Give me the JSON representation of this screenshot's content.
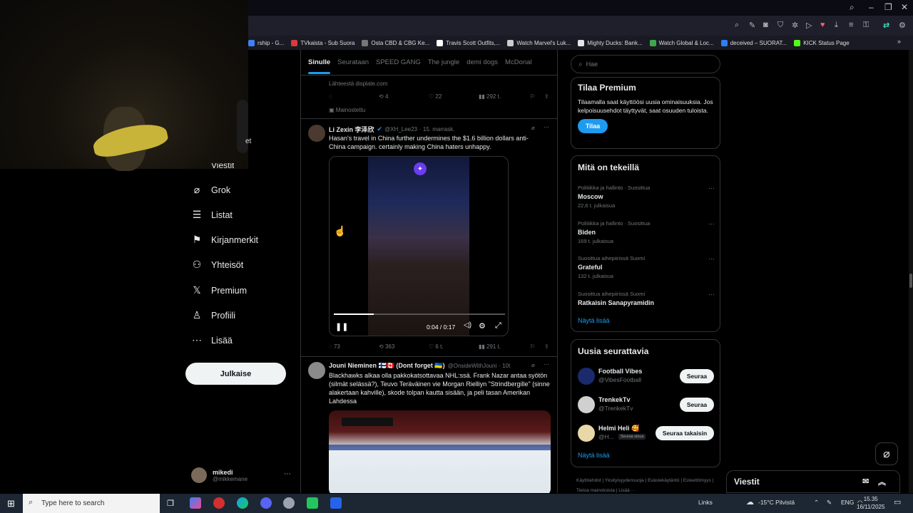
{
  "browser": {
    "bookmarks": [
      {
        "label": "rship - G...",
        "color": "#3b82f6"
      },
      {
        "label": "TVkaista - Sub Suora",
        "color": "#d83a3a"
      },
      {
        "label": "Osta CBD & CBG Ke...",
        "color": "#777777"
      },
      {
        "label": "Travis Scott Outfits,...",
        "color": "#ffffff"
      },
      {
        "label": "Watch Marvel's Luk...",
        "color": "#cccccc"
      },
      {
        "label": "Mighty Ducks: Bank...",
        "color": "#e5e5e5"
      },
      {
        "label": "Watch Global & Loc...",
        "color": "#3da84a"
      },
      {
        "label": "deceived – SUORAT...",
        "color": "#2d7ef7"
      },
      {
        "label": "KICK Status Page",
        "color": "#53fc18"
      }
    ]
  },
  "webcam": {
    "overlay_text": "et"
  },
  "sidebar": {
    "partial_top": "Viestit",
    "items": [
      {
        "label": "Grok",
        "icon": "grok-icon",
        "glyph": "⌀"
      },
      {
        "label": "Listat",
        "icon": "list-icon",
        "glyph": "☰"
      },
      {
        "label": "Kirjanmerkit",
        "icon": "bookmark-icon",
        "glyph": "⚑"
      },
      {
        "label": "Yhteisöt",
        "icon": "communities-icon",
        "glyph": "⚇"
      },
      {
        "label": "Premium",
        "icon": "x-logo-icon",
        "glyph": "𝕏"
      },
      {
        "label": "Profiili",
        "icon": "profile-icon",
        "glyph": "♙"
      },
      {
        "label": "Lisää",
        "icon": "more-icon",
        "glyph": "⋯"
      }
    ],
    "post_button": "Julkaise",
    "account": {
      "name": "mikedi",
      "handle": "@mikkemane"
    }
  },
  "feed": {
    "tabs": [
      "Sinulle",
      "Seurataan",
      "SPEED GANG",
      "The jungle",
      "demi dogs",
      "McDonal"
    ],
    "top_tweet": {
      "source": "Lähteestä displate.com",
      "retweets": "4",
      "likes": "22",
      "views": "292 t.",
      "promoted": "Mainostettu"
    },
    "tweet1": {
      "name": "Li Zexin 李泽欣",
      "handle": "@XH_Lee23",
      "date": "· 15. marrask.",
      "text": "Hasan's travel in China further undermines the $1.6 billion dollars anti-China campaign. certainly making China haters unhappy.",
      "video_time": "0:04 / 0:17",
      "video_progress": 0.235,
      "replies": "73",
      "retweets": "363",
      "likes": "6 t.",
      "views": "291 t."
    },
    "tweet2": {
      "name": "Jouni Nieminen 🇫🇮🇨🇦 (Dont forget 🇺🇦)",
      "handle": "@OnsideWithJouni",
      "date": "· 10t",
      "text": "Blackhawks alkaa olla pakkokatsottavaa NHL:ssä. Frank Nazar antaa syötön (silmät selässä?), Teuvo Teräväinen vie Morgan Rielliyn \"Strindbergille\" (sinne alakertaan kahville), skode tolpan kautta sisään, ja peli tasan Amerikan Lahdessa"
    }
  },
  "right": {
    "search_placeholder": "Hae",
    "premium": {
      "title": "Tilaa Premium",
      "text": "Tilaamalla saat käyttöösi uusia ominaisuuksia. Jos kelpoisuusehdot täyttyvät, saat osuuden tuloista.",
      "button": "Tilaa"
    },
    "trends": {
      "title": "Mitä on tekeillä",
      "items": [
        {
          "meta": "Politiikka ja hallinto · Suosittua",
          "name": "Moscow",
          "count": "22,6 t. julkaisua"
        },
        {
          "meta": "Politiikka ja hallinto · Suosittua",
          "name": "Biden",
          "count": "169 t. julkaisua"
        },
        {
          "meta": "Suosittua aihepiirissä Suomi",
          "name": "Grateful",
          "count": "132 t. julkaisua"
        },
        {
          "meta": "Suosittua aihepiirissä Suomi",
          "name": "Ratkaisin Sanapyramidin",
          "count": ""
        }
      ],
      "show_more": "Näytä lisää"
    },
    "follow": {
      "title": "Uusia seurattavia",
      "items": [
        {
          "name": "Football Vibes",
          "handle": "@VibesFootball",
          "button": "Seuraa",
          "badge": ""
        },
        {
          "name": "TrenkekTv",
          "handle": "@TrenkekTv",
          "button": "Seuraa",
          "badge": ""
        },
        {
          "name": "Helmi Heli 🥰",
          "handle": "@H...",
          "button": "Seuraa takaisin",
          "badge": "Seuraa sinua"
        }
      ],
      "show_more": "Näytä lisää"
    },
    "footer": "Käyttöehdot | Yksityisyydensuoja | Evästekäytäntö | Esteettömyys | Tietoa mainoksista | Lisää ···",
    "messages_label": "Viestit"
  },
  "taskbar": {
    "search_placeholder": "Type here to search",
    "links": "Links",
    "weather": "-15°C Pilvistä",
    "lang": "ENG",
    "time": "15.35",
    "date": "16/11/2025"
  }
}
